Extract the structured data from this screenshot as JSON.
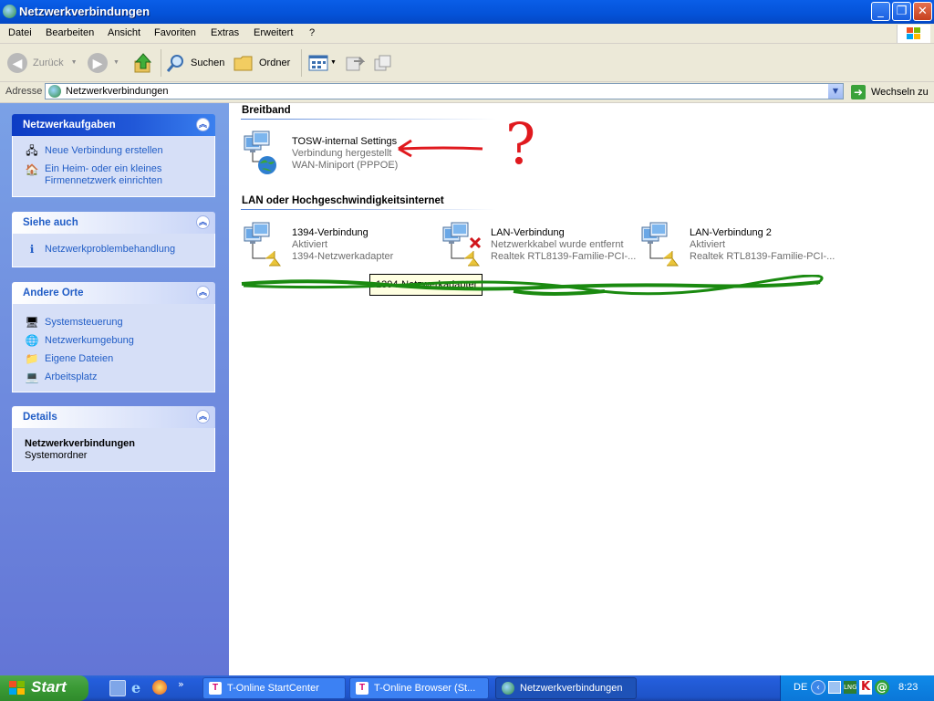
{
  "window": {
    "title": "Netzwerkverbindungen"
  },
  "menu": [
    "Datei",
    "Bearbeiten",
    "Ansicht",
    "Favoriten",
    "Extras",
    "Erweitert",
    "?"
  ],
  "toolbar": {
    "back": "Zurück",
    "search": "Suchen",
    "folders": "Ordner"
  },
  "address": {
    "label": "Adresse",
    "value": "Netzwerkverbindungen",
    "go": "Wechseln zu"
  },
  "left": {
    "tasks": {
      "title": "Netzwerkaufgaben",
      "items": [
        "Neue Verbindung erstellen",
        "Ein Heim- oder ein kleines",
        "Firmennetzwerk einrichten"
      ]
    },
    "see_also": {
      "title": "Siehe auch",
      "items": [
        "Netzwerkproblembehandlung"
      ]
    },
    "other": {
      "title": "Andere Orte",
      "items": [
        "Systemsteuerung",
        "Netzwerkumgebung",
        "Eigene Dateien",
        "Arbeitsplatz"
      ]
    },
    "details": {
      "title": "Details",
      "name": "Netzwerkverbindungen",
      "type": "Systemordner"
    }
  },
  "content": {
    "broadband": {
      "title": "Breitband",
      "items": [
        {
          "name": "TOSW-internal Settings",
          "status": "Verbindung hergestellt",
          "device": "WAN-Miniport (PPPOE)"
        }
      ]
    },
    "lan": {
      "title": "LAN oder Hochgeschwindigkeitsinternet",
      "items": [
        {
          "name": "1394-Verbindung",
          "status": "Aktiviert",
          "device": "1394-Netzwerkadapter"
        },
        {
          "name": "LAN-Verbindung",
          "status": "Netzwerkkabel wurde entfernt",
          "device": "Realtek RTL8139-Familie-PCI-..."
        },
        {
          "name": "LAN-Verbindung 2",
          "status": "Aktiviert",
          "device": "Realtek RTL8139-Familie-PCI-..."
        }
      ]
    },
    "tooltip": "1394-Netzwerkadapter",
    "annotation": "?"
  },
  "taskbar": {
    "start": "Start",
    "tasks": [
      "T-Online StartCenter",
      "T-Online Browser (St...",
      "Netzwerkverbindungen"
    ],
    "lang": "DE",
    "clock": "8:23"
  },
  "colors": {
    "link": "#215dc6",
    "taskbar": "#245edc",
    "start": "#3a9a35",
    "annotation_red": "#e0191e",
    "annotation_green": "#1a8a10"
  }
}
